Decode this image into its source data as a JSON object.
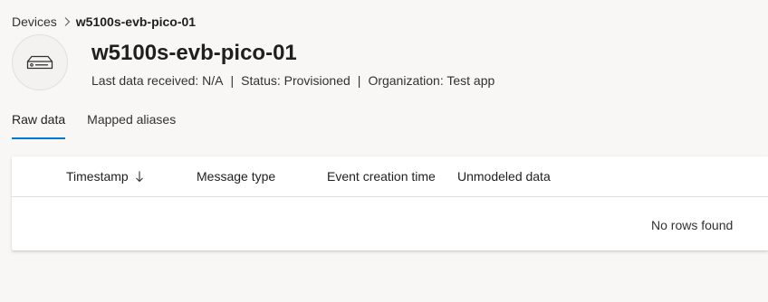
{
  "breadcrumb": {
    "parent": "Devices",
    "current": "w5100s-evb-pico-01"
  },
  "device": {
    "icon": "device-box-icon",
    "name": "w5100s-evb-pico-01",
    "last_data": "Last data received: N/A",
    "status": "Status: Provisioned",
    "organization": "Organization: Test app",
    "separator": "|"
  },
  "tabs": [
    {
      "label": "Raw data",
      "active": true
    },
    {
      "label": "Mapped aliases",
      "active": false
    }
  ],
  "table": {
    "columns": [
      {
        "label": "Timestamp",
        "sort": "descending"
      },
      {
        "label": "Message type"
      },
      {
        "label": "Event creation time"
      },
      {
        "label": "Unmodeled data"
      }
    ],
    "empty_message": "No rows found"
  },
  "colors": {
    "accent": "#0078d4",
    "background": "#f8f7f6"
  }
}
